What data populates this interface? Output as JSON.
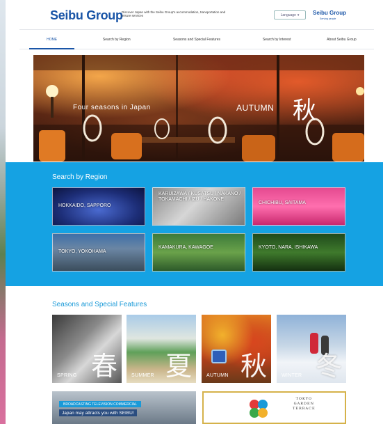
{
  "header": {
    "logo": "Seibu Group",
    "tagline": "Discover Japan with the Seibu Group's accommodation, transportation and leisure services",
    "language_label": "Language",
    "logo_small": "Seibu Group",
    "logo_small_sub": "Serving people"
  },
  "nav": {
    "items": [
      {
        "label": "HOME"
      },
      {
        "label": "Search by Region"
      },
      {
        "label": "Seasons and Special Features"
      },
      {
        "label": "Search by Interest"
      },
      {
        "label": "About Seibu Group"
      }
    ]
  },
  "hero": {
    "left_text": "Four seasons in Japan",
    "season_text": "AUTUMN",
    "kanji": "秋"
  },
  "region": {
    "title": "Search by Region",
    "tiles": [
      {
        "label": "HOKKAIDO, SAPPORO"
      },
      {
        "label": "KARUIZAWA / KUSATSU / NAKANO / TOKAMACHI / IZU / HAKONE"
      },
      {
        "label": "CHICHIBU, SAITAMA"
      },
      {
        "label": "TOKYO, YOKOHAMA"
      },
      {
        "label": "KAMAKURA, KAWAGOE"
      },
      {
        "label": "KYOTO, NARA, ISHIKAWA"
      }
    ]
  },
  "seasons": {
    "title": "Seasons and Special Features",
    "items": [
      {
        "label": "SPRING",
        "kanji": "春"
      },
      {
        "label": "SUMMER",
        "kanji": "夏"
      },
      {
        "label": "AUTUMN",
        "kanji": "秋"
      },
      {
        "label": "WINTER",
        "kanji": "冬"
      }
    ]
  },
  "banners": {
    "cm_tag": "BROADCASTING TELEVISION COMMERCIAL",
    "cm_text": "Japan may attracts you with SEIBU!",
    "tgt_line1": "TOKYO",
    "tgt_line2": "GARDEN",
    "tgt_line3": "TERRACE"
  },
  "colors": {
    "brand_blue": "#1a55a7",
    "region_bg": "#15a2e3",
    "section_title": "#1a9ad8",
    "banner_gold": "#d5b24a"
  }
}
